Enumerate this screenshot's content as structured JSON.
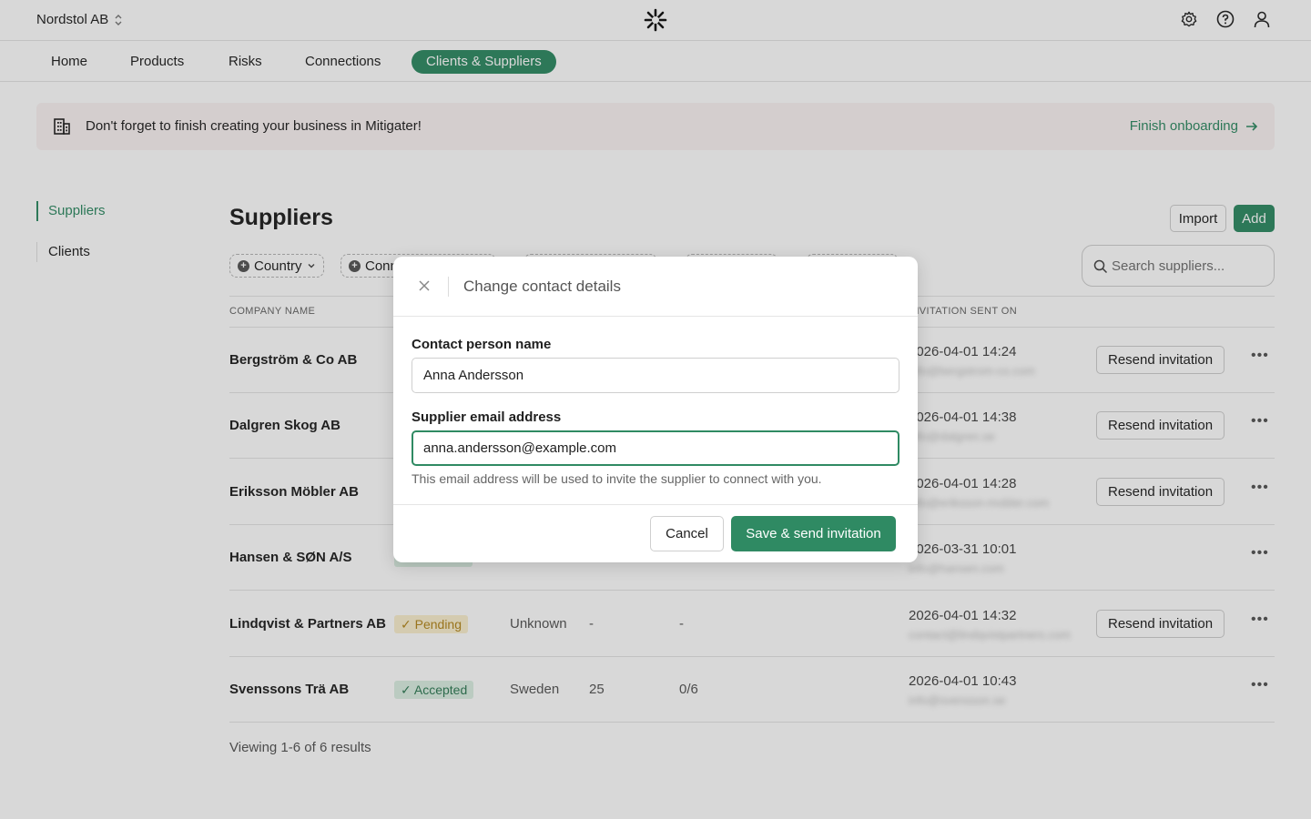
{
  "header": {
    "org_name": "Nordstol AB"
  },
  "nav": {
    "items": [
      {
        "label": "Home"
      },
      {
        "label": "Products"
      },
      {
        "label": "Risks"
      },
      {
        "label": "Connections"
      },
      {
        "label": "Clients & Suppliers",
        "active": true
      }
    ]
  },
  "banner": {
    "text": "Don't forget to finish creating your business in Mitigater!",
    "link": "Finish onboarding"
  },
  "sidebar": {
    "items": [
      {
        "label": "Suppliers",
        "active": true
      },
      {
        "label": "Clients"
      }
    ]
  },
  "page": {
    "title": "Suppliers",
    "import_label": "Import",
    "add_label": "Add",
    "search_placeholder": "Search suppliers...",
    "filters": [
      "Country",
      "Conn"
    ]
  },
  "table": {
    "headers": {
      "company": "Company name",
      "invitation": "Invitation sent on"
    },
    "rows": [
      {
        "name": "Bergström & Co AB",
        "status": "",
        "country": "",
        "num": "",
        "ratio": "",
        "date": "2026-04-01 14:24",
        "email": "info@bergstrom-co.com",
        "resend": "Resend invitation"
      },
      {
        "name": "Dalgren Skog AB",
        "status": "",
        "country": "",
        "num": "",
        "ratio": "",
        "date": "2026-04-01 14:38",
        "email": "info@dalgren.se",
        "resend": "Resend invitation"
      },
      {
        "name": "Eriksson Möbler AB",
        "status": "",
        "country": "",
        "num": "",
        "ratio": "",
        "date": "2026-04-01 14:28",
        "email": "info@eriksson-mobler.com",
        "resend": "Resend invitation"
      },
      {
        "name": "Hansen & SØN A/S",
        "status": "",
        "country": "",
        "num": "",
        "ratio": "",
        "date": "2026-03-31 10:01",
        "email": "info@hansen.com",
        "resend": ""
      },
      {
        "name": "Lindqvist & Partners AB",
        "status": "Pending",
        "country": "Unknown",
        "num": "-",
        "ratio": "-",
        "date": "2026-04-01 14:32",
        "email": "contact@lindqvistpartners.com",
        "resend": "Resend invitation"
      },
      {
        "name": "Svenssons Trä AB",
        "status": "Accepted",
        "country": "Sweden",
        "num": "25",
        "ratio": "0/6",
        "date": "2026-04-01 10:43",
        "email": "info@svensson.se",
        "resend": ""
      }
    ],
    "footer": "Viewing 1-6 of 6 results"
  },
  "modal": {
    "title": "Change contact details",
    "name_label": "Contact person name",
    "name_value": "Anna Andersson",
    "email_label": "Supplier email address",
    "email_value": "anna.andersson@example.com",
    "hint": "This email address will be used to invite the supplier to connect with you.",
    "cancel_label": "Cancel",
    "save_label": "Save & send invitation"
  },
  "colors": {
    "accent": "#2f8a63",
    "pending_bg": "#fbf0cf",
    "accepted_bg": "#dcefe3"
  }
}
